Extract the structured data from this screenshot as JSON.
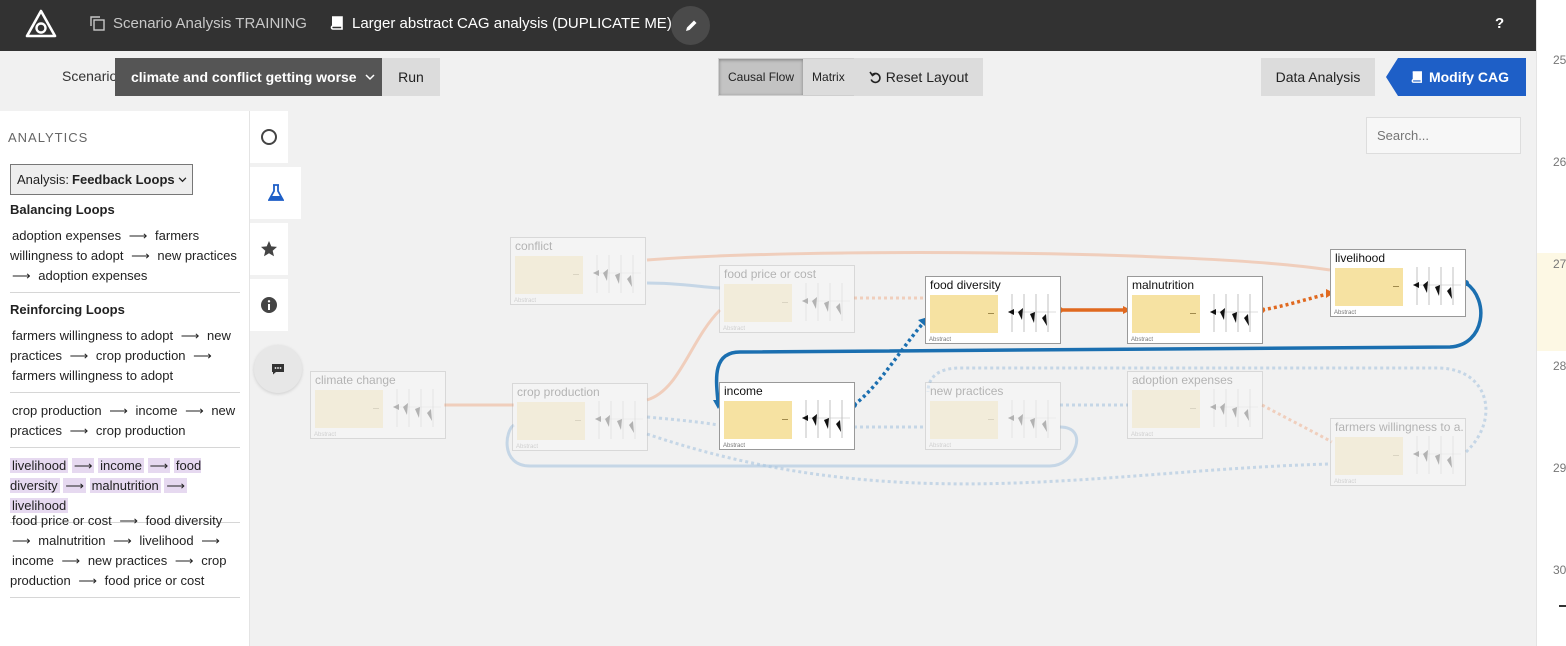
{
  "header": {
    "project_name": "Scenario Analysis TRAINING",
    "model_name": "Larger abstract CAG analysis (DUPLICATE ME)",
    "help_label": "?"
  },
  "toolbar": {
    "scenario_label": "Scenario",
    "scenario_value": "climate and conflict getting worse",
    "run_label": "Run",
    "view_causal": "Causal Flow",
    "view_matrix": "Matrix",
    "reset_label": "Reset Layout",
    "data_analysis_label": "Data Analysis",
    "modify_label": "Modify CAG"
  },
  "search": {
    "placeholder": "Search..."
  },
  "gutter_numbers": [
    "25",
    "26",
    "27",
    "28",
    "29",
    "30"
  ],
  "analytics": {
    "title": "ANALYTICS",
    "analysis_prefix": "Analysis:",
    "analysis_value": "Feedback Loops",
    "balancing_title": "Balancing Loops",
    "reinforcing_title": "Reinforcing Loops",
    "balancing_loops": [
      [
        "adoption expenses",
        "farmers willingness to adopt",
        "new practices",
        "adoption expenses"
      ]
    ],
    "reinforcing_loops": [
      [
        "farmers willingness to adopt",
        "new practices",
        "crop production",
        "farmers willingness to adopt"
      ],
      [
        "crop production",
        "income",
        "new practices",
        "crop production"
      ],
      [
        "livelihood",
        "income",
        "food diversity",
        "malnutrition",
        "livelihood"
      ],
      [
        "food price or cost",
        "food diversity",
        "malnutrition",
        "livelihood",
        "income",
        "new practices",
        "crop production",
        "food price or cost"
      ]
    ]
  },
  "graph": {
    "nodes": [
      {
        "label": "conflict",
        "faded": true
      },
      {
        "label": "food price or cost",
        "faded": true
      },
      {
        "label": "food diversity",
        "faded": false
      },
      {
        "label": "malnutrition",
        "faded": false
      },
      {
        "label": "livelihood",
        "faded": false
      },
      {
        "label": "climate change",
        "faded": true
      },
      {
        "label": "crop production",
        "faded": true
      },
      {
        "label": "income",
        "faded": false
      },
      {
        "label": "new practices",
        "faded": true
      },
      {
        "label": "adoption expenses",
        "faded": true
      },
      {
        "label": "farmers willingness to a...",
        "faded": true
      }
    ],
    "node_caption": "Abstract",
    "colors": {
      "increase": "#e0691f",
      "decrease": "#1b6fb0",
      "node_fill": "#f6e2a2",
      "faded_increase": "#f0b79a",
      "faded_decrease": "#a8c4e0"
    }
  },
  "icons": {
    "logo": "app-logo-icon",
    "project": "project-copy-icon",
    "model": "book-icon",
    "edit": "pencil-icon",
    "reset": "undo-icon",
    "modify": "book-icon",
    "tabs": [
      "circle-icon",
      "flask-icon",
      "star-icon",
      "info-icon"
    ],
    "chat": "chat-bubble-icon"
  }
}
